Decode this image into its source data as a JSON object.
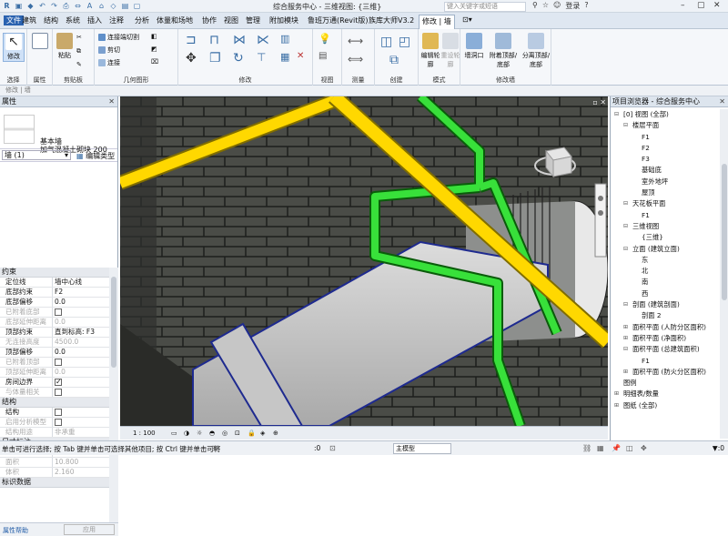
{
  "app": {
    "title": "综合服务中心 - 三维视图: {三维}",
    "search_placeholder": "键入关键字或短语",
    "login_label": "登录",
    "logo": "R"
  },
  "tabs": [
    "建筑",
    "结构",
    "系统",
    "插入",
    "注释",
    "分析",
    "体量和场地",
    "协作",
    "视图",
    "管理",
    "附加模块",
    "鲁班万通(Revit版)",
    "族库大师V3.2",
    "修改 | 墙"
  ],
  "ribbon": {
    "select": {
      "label": "修改",
      "panel": "选择"
    },
    "properties": {
      "label": "属性",
      "panel": "属性"
    },
    "clipboard": {
      "paste_label": "粘贴",
      "panel": "剪贴板"
    },
    "geometry": {
      "items": [
        "连接端切割",
        "剪切",
        "连接"
      ],
      "panel": "几何图形"
    },
    "modify": {
      "panel": "修改"
    },
    "view": {
      "panel": "视图"
    },
    "measure": {
      "panel": "测量"
    },
    "create": {
      "panel": "创建"
    },
    "mode": {
      "edit_profile": "编辑轮廓",
      "reset_profile": "重设轮廓",
      "panel": "模式"
    },
    "modify_wall": {
      "items": [
        "墙洞口",
        "附着顶部/底部",
        "分离顶部/底部"
      ],
      "panel": "修改墙"
    }
  },
  "optionsbar": {
    "label": "修改 | 墙"
  },
  "properties": {
    "header": "属性",
    "type_family": "基本墙",
    "type_name": "加气混凝土砌块 200",
    "selector": "墙 (1)",
    "edit_type": "编辑类型",
    "sections": [
      {
        "title": "约束",
        "rows": [
          {
            "k": "定位线",
            "v": "墙中心线",
            "dis": false,
            "cb": null
          },
          {
            "k": "底部约束",
            "v": "F2",
            "dis": false,
            "cb": null
          },
          {
            "k": "底部偏移",
            "v": "0.0",
            "dis": false,
            "cb": null
          },
          {
            "k": "已附着底部",
            "v": "",
            "dis": true,
            "cb": false
          },
          {
            "k": "底部延伸距离",
            "v": "0.0",
            "dis": true,
            "cb": null
          },
          {
            "k": "顶部约束",
            "v": "直到标高: F3",
            "dis": false,
            "cb": null
          },
          {
            "k": "无连接高度",
            "v": "4500.0",
            "dis": true,
            "cb": null
          },
          {
            "k": "顶部偏移",
            "v": "0.0",
            "dis": false,
            "cb": null
          },
          {
            "k": "已附着顶部",
            "v": "",
            "dis": true,
            "cb": false
          },
          {
            "k": "顶部延伸距离",
            "v": "0.0",
            "dis": true,
            "cb": null
          },
          {
            "k": "房间边界",
            "v": "",
            "dis": false,
            "cb": true
          },
          {
            "k": "与体量相关",
            "v": "",
            "dis": true,
            "cb": false
          }
        ]
      },
      {
        "title": "结构",
        "rows": [
          {
            "k": "结构",
            "v": "",
            "dis": false,
            "cb": false
          },
          {
            "k": "启用分析模型",
            "v": "",
            "dis": true,
            "cb": false
          },
          {
            "k": "结构用途",
            "v": "非承重",
            "dis": true,
            "cb": null
          }
        ]
      },
      {
        "title": "尺寸标注",
        "rows": [
          {
            "k": "长度",
            "v": "2550.0",
            "dis": true,
            "cb": null
          },
          {
            "k": "面积",
            "v": "10.800",
            "dis": true,
            "cb": null
          },
          {
            "k": "体积",
            "v": "2.160",
            "dis": true,
            "cb": null
          }
        ]
      },
      {
        "title": "标识数据",
        "rows": []
      }
    ],
    "help_link": "属性帮助",
    "apply": "应用"
  },
  "view": {
    "scale": "1 : 100"
  },
  "browser": {
    "header": "项目浏览器 - 综合服务中心",
    "tree": [
      {
        "d": 0,
        "t": "[0] 视图 (全部)",
        "tg": "-"
      },
      {
        "d": 1,
        "t": "楼层平面",
        "tg": "-"
      },
      {
        "d": 2,
        "t": "F1",
        "tg": ""
      },
      {
        "d": 2,
        "t": "F2",
        "tg": ""
      },
      {
        "d": 2,
        "t": "F3",
        "tg": ""
      },
      {
        "d": 2,
        "t": "基础底",
        "tg": ""
      },
      {
        "d": 2,
        "t": "室外地坪",
        "tg": ""
      },
      {
        "d": 2,
        "t": "屋顶",
        "tg": ""
      },
      {
        "d": 1,
        "t": "天花板平面",
        "tg": "-"
      },
      {
        "d": 2,
        "t": "F1",
        "tg": ""
      },
      {
        "d": 1,
        "t": "三维视图",
        "tg": "-"
      },
      {
        "d": 2,
        "t": "{三维}",
        "tg": ""
      },
      {
        "d": 1,
        "t": "立面 (建筑立面)",
        "tg": "-"
      },
      {
        "d": 2,
        "t": "东",
        "tg": ""
      },
      {
        "d": 2,
        "t": "北",
        "tg": ""
      },
      {
        "d": 2,
        "t": "南",
        "tg": ""
      },
      {
        "d": 2,
        "t": "西",
        "tg": ""
      },
      {
        "d": 1,
        "t": "剖面 (建筑剖面)",
        "tg": "-"
      },
      {
        "d": 2,
        "t": "剖面 2",
        "tg": ""
      },
      {
        "d": 1,
        "t": "面积平面 (人防分区面积)",
        "tg": "+"
      },
      {
        "d": 1,
        "t": "面积平面 (净面积)",
        "tg": "+"
      },
      {
        "d": 1,
        "t": "面积平面 (总建筑面积)",
        "tg": "-"
      },
      {
        "d": 2,
        "t": "F1",
        "tg": ""
      },
      {
        "d": 1,
        "t": "面积平面 (防火分区面积)",
        "tg": "+"
      },
      {
        "d": 0,
        "t": "图例",
        "tg": ""
      },
      {
        "d": 0,
        "t": "明细表/数量",
        "tg": "+"
      },
      {
        "d": 0,
        "t": "图纸 (全部)",
        "tg": "+"
      }
    ]
  },
  "status": {
    "message": "单击可进行选择; 按 Tab 键并单击可选择其他项目; 按 Ctrl 键并单击可将",
    "zero": ":0",
    "model": "主模型"
  }
}
